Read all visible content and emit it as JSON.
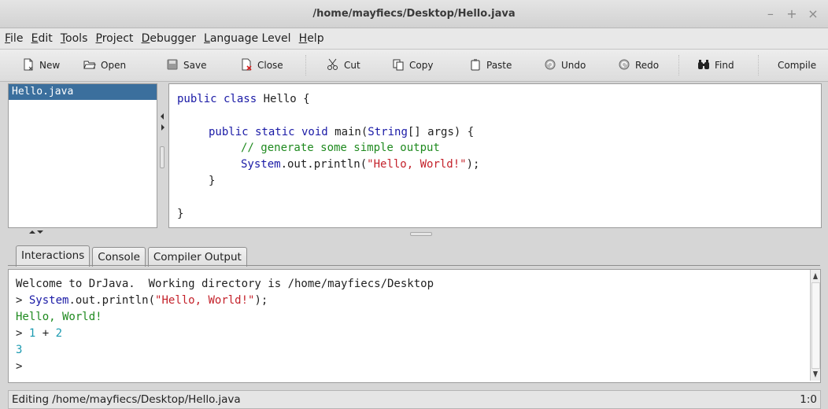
{
  "window": {
    "title": "/home/mayfiecs/Desktop/Hello.java",
    "controls": [
      "–",
      "+",
      "×"
    ]
  },
  "menu": [
    {
      "u": "F",
      "rest": "ile"
    },
    {
      "u": "E",
      "rest": "dit"
    },
    {
      "u": "T",
      "rest": "ools"
    },
    {
      "u": "P",
      "rest": "roject"
    },
    {
      "u": "D",
      "rest": "ebugger"
    },
    {
      "u": "L",
      "rest": "anguage Level"
    },
    {
      "u": "H",
      "rest": "elp"
    }
  ],
  "toolbar": {
    "new": "New",
    "open": "Open",
    "save": "Save",
    "close": "Close",
    "cut": "Cut",
    "copy": "Copy",
    "paste": "Paste",
    "undo": "Undo",
    "redo": "Redo",
    "find": "Find",
    "compile": "Compile"
  },
  "files": [
    "Hello.java"
  ],
  "editor": {
    "line1_kw": "public class",
    "line1_rest": " Hello {",
    "line3_kw": "public static void",
    "line3_mid": " main(",
    "line3_type": "String",
    "line3_rest": "[] args) {",
    "line4": "// generate some simple output",
    "line5_kw": "System",
    "line5_mid": ".out.println(",
    "line5_str": "\"Hello, World!\"",
    "line5_end": ");",
    "line6": "}",
    "line8": "}"
  },
  "tabs": [
    "Interactions",
    "Console",
    "Compiler Output"
  ],
  "interactions": {
    "welcome": "Welcome to DrJava.  Working directory is /home/mayfiecs/Desktop",
    "prompt": ">",
    "cmd1_kw": "System",
    "cmd1_mid": ".out.println(",
    "cmd1_str": "\"Hello, World!\"",
    "cmd1_end": ");",
    "out1": "Hello, World!",
    "cmd2_a": "1",
    "cmd2_op": "+",
    "cmd2_b": "2",
    "out2": "3"
  },
  "status": {
    "text": "Editing /home/mayfiecs/Desktop/Hello.java",
    "pos": "1:0"
  },
  "colors": {
    "keyword": "#1a1aa6",
    "comment": "#1f8a1f",
    "string": "#c4222b",
    "number": "#1b9ab0",
    "selection": "#3b6f9d"
  }
}
